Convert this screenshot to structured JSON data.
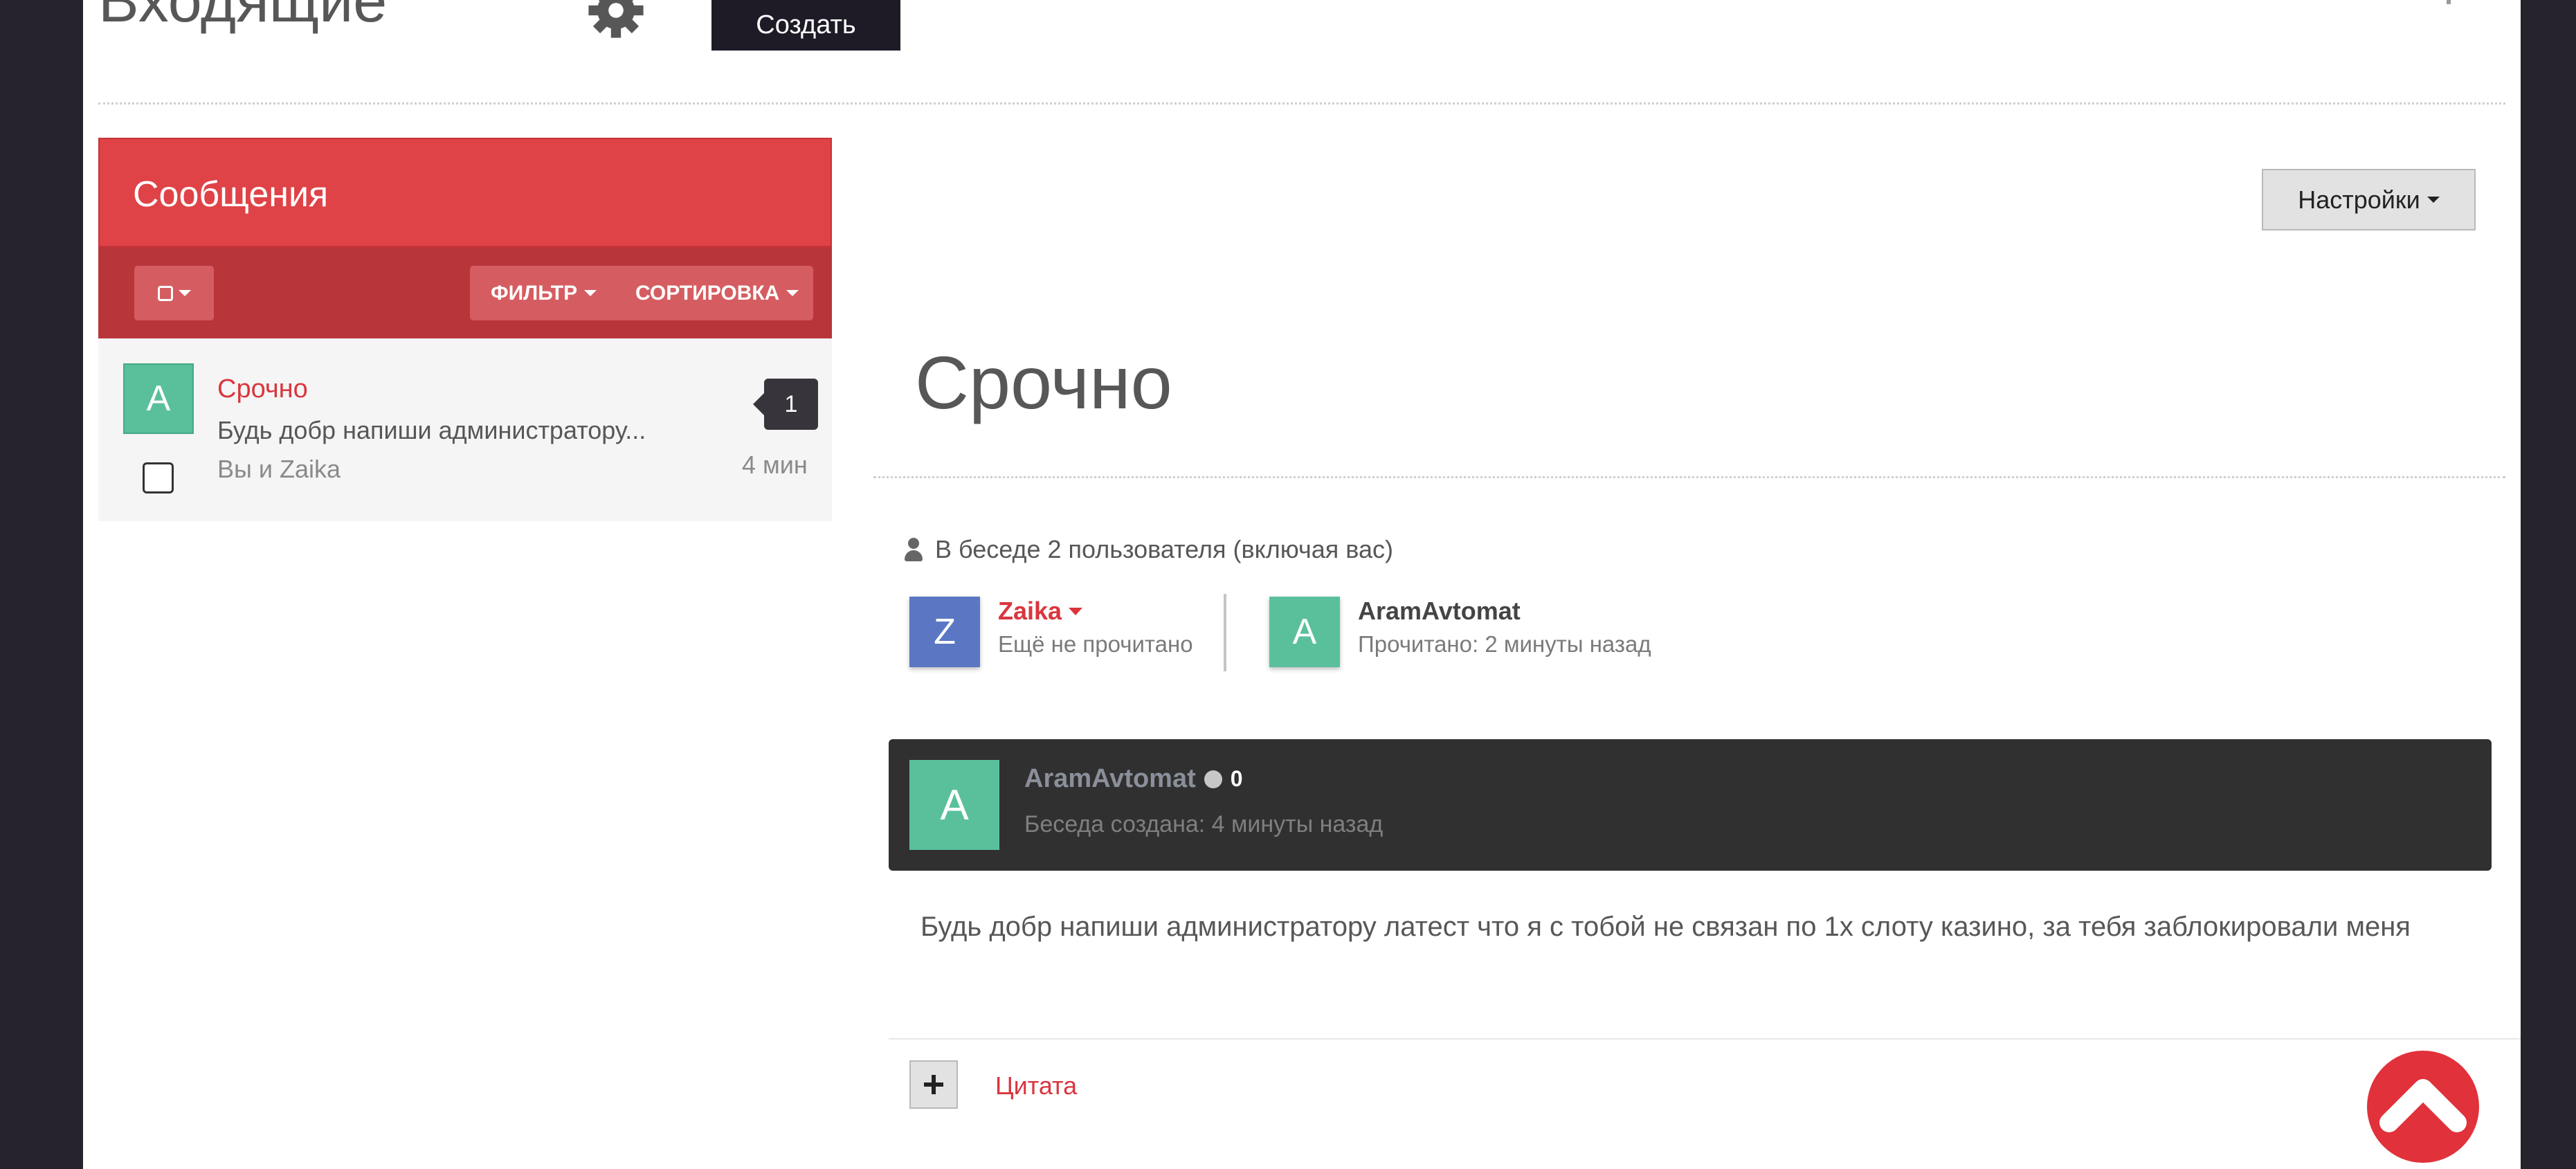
{
  "header": {
    "title": "Входящие",
    "create_label": "Создать"
  },
  "sidebar": {
    "panel_title": "Сообщения",
    "filter_label": "ФИЛЬТР",
    "sort_label": "СОРТИРОВКА",
    "conversation": {
      "avatar_letter": "A",
      "subject": "Срочно",
      "preview": "Будь добр напиши администратору...",
      "participants": "Вы и Zaika",
      "unread_count": "1",
      "time": "4 мин"
    }
  },
  "main": {
    "settings_label": "Настройки",
    "conversation_title": "Срочно",
    "participants_info": "В беседе 2 пользователя (включая вас)",
    "participants": [
      {
        "avatar_letter": "Z",
        "name": "Zaika",
        "status": "Ещё не прочитано"
      },
      {
        "avatar_letter": "A",
        "name": "AramAvtomat",
        "status": "Прочитано: 2 минуты назад"
      }
    ],
    "message": {
      "avatar_letter": "A",
      "author": "AramAvtomat",
      "reputation": "0",
      "created": "Беседа создана: 4 минуты назад",
      "body": "Будь добр напиши администратору латест что я с тобой не связан по 1х слоту казино, за тебя заблокировали меня"
    },
    "quote_label": "Цитата"
  },
  "colors": {
    "accent_red": "#df4347",
    "toolbar_red": "#b8353a",
    "dark": "#303030",
    "avatar_green": "#5ac09c",
    "avatar_blue": "#5b77c4"
  },
  "icons": {
    "settings": "gear-icon",
    "add": "plus-icon",
    "scroll_top": "chevron-up-icon",
    "participants": "user-icon"
  }
}
